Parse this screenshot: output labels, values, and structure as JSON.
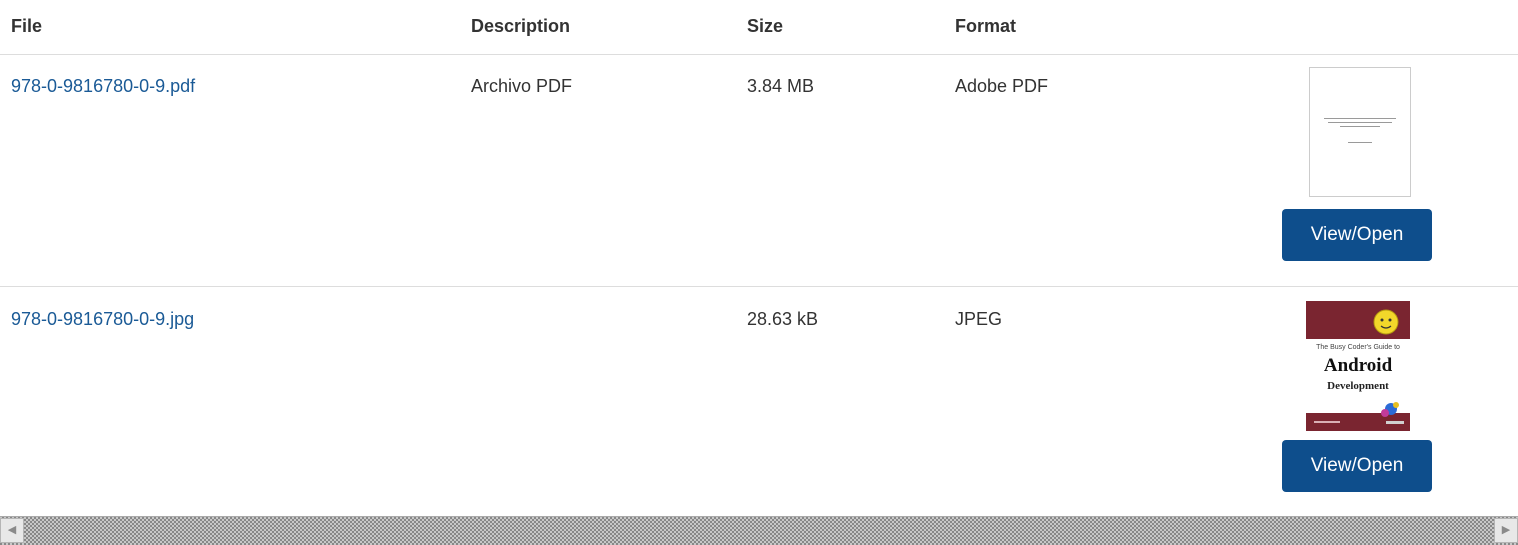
{
  "columns": {
    "file": "File",
    "description": "Description",
    "size": "Size",
    "format": "Format"
  },
  "rows": [
    {
      "file": "978-0-9816780-0-9.pdf",
      "description": "Archivo PDF",
      "size": "3.84 MB",
      "format": "Adobe PDF",
      "action": "View/Open"
    },
    {
      "file": "978-0-9816780-0-9.jpg",
      "description": "",
      "size": "28.63 kB",
      "format": "JPEG",
      "action": "View/Open",
      "thumbnail": {
        "line1": "The Busy Coder's Guide to",
        "line2": "Android",
        "line3": "Development"
      }
    }
  ],
  "colors": {
    "link": "#1a5a96",
    "button": "#0e4e8c",
    "divider": "#dddddd"
  },
  "icons": {
    "scroll_left": "triangle-left-icon",
    "scroll_right": "triangle-right-icon"
  }
}
